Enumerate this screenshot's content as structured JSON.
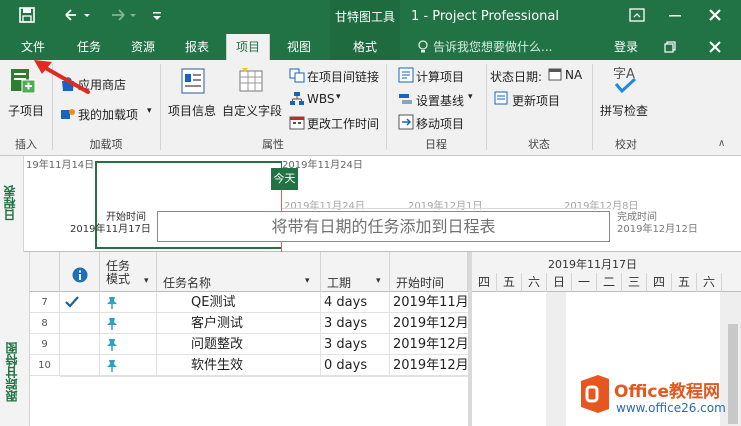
{
  "titlebar": {
    "tool_tab": "甘特图工具",
    "title": "1 - Project Professional"
  },
  "tabs": {
    "file": "文件",
    "task": "任务",
    "resource": "资源",
    "report": "报表",
    "project": "项目",
    "view": "视图",
    "format": "格式",
    "tell_me": "告诉我您想要做什么...",
    "login": "登录"
  },
  "ribbon": {
    "subproject": "子项目",
    "app_store": "应用商店",
    "my_addins": "我的加载项",
    "project_info": "项目信息",
    "custom_fields": "自定义字段",
    "links_between": "在项目间链接",
    "wbs": "WBS",
    "change_work_time": "更改工作时间",
    "calc_project": "计算项目",
    "set_baseline": "设置基线",
    "move_project": "移动项目",
    "status_date_label": "状态日期:",
    "status_date_value": "NA",
    "update_project": "更新项目",
    "spelling": "拼写检查",
    "groups": {
      "insert": "插入",
      "addins": "加载项",
      "properties": "属性",
      "schedule": "日程",
      "status": "状态",
      "proofing": "校对"
    }
  },
  "timeline": {
    "side_label": "日程表",
    "top_date_left": "19年11月14日",
    "top_date_mid": "2019年11月24日",
    "today": "今天",
    "start_label": "开始时间",
    "start_date": "2019年11月17日",
    "tick1": "2019年11月24日",
    "tick2": "2019年12月1日",
    "tick3": "2019年12月8日",
    "finish_label": "完成时间",
    "finish_date": "2019年12月12日",
    "placeholder": "将带有日期的任务添加到日程表"
  },
  "grid": {
    "side_label": "跟踪甘特图",
    "headers": {
      "task_mode": "任务\n模式",
      "task_name": "任务名称",
      "duration": "工期",
      "start": "开始时间"
    },
    "gantt_date": "2019年11月17日",
    "days": [
      "四",
      "五",
      "六",
      "日",
      "一",
      "二",
      "三",
      "四",
      "五",
      "六"
    ],
    "rows": [
      {
        "id": "7",
        "name": "QE测试",
        "duration": "4 days",
        "start": "2019年11月"
      },
      {
        "id": "8",
        "name": "客户测试",
        "duration": "3 days",
        "start": "2019年12月"
      },
      {
        "id": "9",
        "name": "问题整改",
        "duration": "3 days",
        "start": "2019年12月"
      },
      {
        "id": "10",
        "name": "软件生效",
        "duration": "0 days",
        "start": "2019年12月"
      }
    ]
  },
  "watermark": {
    "brand": "Office教程网",
    "url": "www.office26.com"
  },
  "colors": {
    "accent": "#217346",
    "arrow": "#e02a20",
    "office_orange": "#e6561f"
  }
}
